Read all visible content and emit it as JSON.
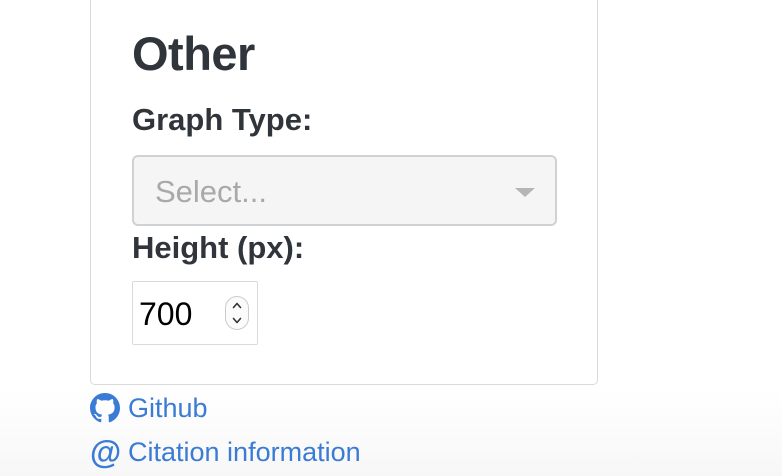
{
  "section": {
    "title": "Other"
  },
  "graph_type": {
    "label": "Graph Type:",
    "placeholder": "Select..."
  },
  "height": {
    "label": "Height (px):",
    "value": "700"
  },
  "links": {
    "github": "Github",
    "citation": "Citation information"
  },
  "icons": {
    "github": "github-icon",
    "citation": "at-sign-icon",
    "dropdown": "chevron-down-icon"
  },
  "colors": {
    "link": "#3a7bd5",
    "heading": "#2f353a",
    "placeholder": "#a7a9ab"
  }
}
